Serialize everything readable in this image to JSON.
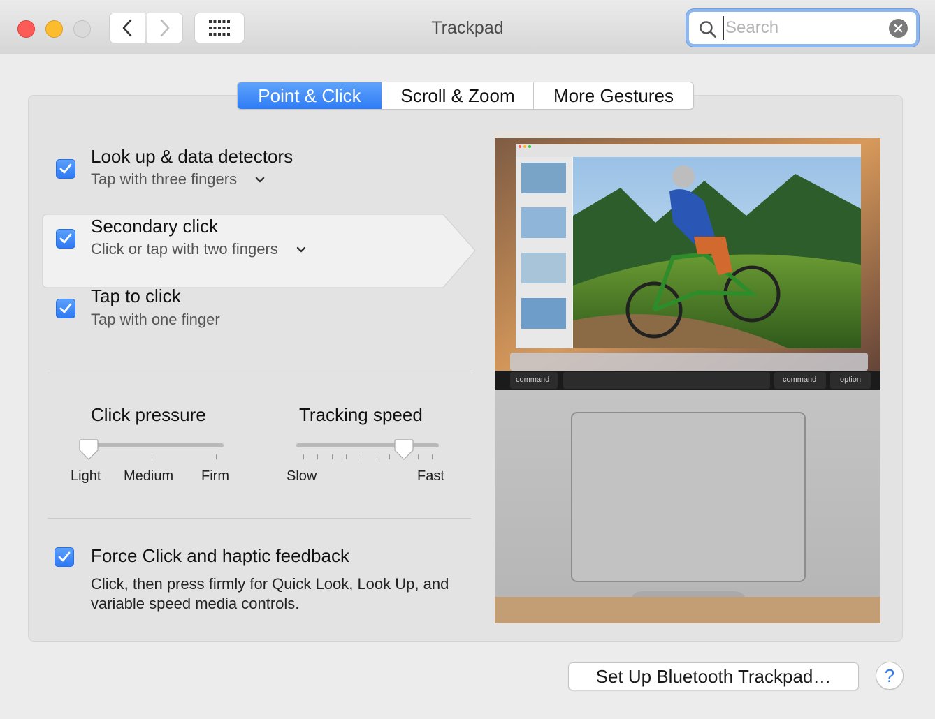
{
  "window": {
    "title": "Trackpad"
  },
  "search": {
    "placeholder": "Search"
  },
  "tabs": [
    {
      "label": "Point & Click",
      "active": true
    },
    {
      "label": "Scroll & Zoom",
      "active": false
    },
    {
      "label": "More Gestures",
      "active": false
    }
  ],
  "options": [
    {
      "title": "Look up & data detectors",
      "subtitle": "Tap with three fingers",
      "checked": true,
      "has_dropdown": true
    },
    {
      "title": "Secondary click",
      "subtitle": "Click or tap with two fingers",
      "checked": true,
      "has_dropdown": true,
      "selected": true
    },
    {
      "title": "Tap to click",
      "subtitle": "Tap with one finger",
      "checked": true,
      "has_dropdown": false
    }
  ],
  "click_pressure": {
    "label": "Click pressure",
    "tick_labels": [
      "Light",
      "Medium",
      "Firm"
    ],
    "value_index": 0
  },
  "tracking_speed": {
    "label": "Tracking speed",
    "min_label": "Slow",
    "max_label": "Fast",
    "value_fraction": 0.7
  },
  "force_click": {
    "title": "Force Click and haptic feedback",
    "description": "Click, then press firmly for Quick Look, Look Up, and variable speed media controls.",
    "checked": true
  },
  "preview": {
    "keyboard_keys": [
      "command",
      "command",
      "option"
    ]
  },
  "footer": {
    "bluetooth_button": "Set Up Bluetooth Trackpad…",
    "help": "?"
  },
  "colors": {
    "accent": "#2f7cf6",
    "close": "#fc5b57",
    "minimize": "#fdbc2e"
  }
}
